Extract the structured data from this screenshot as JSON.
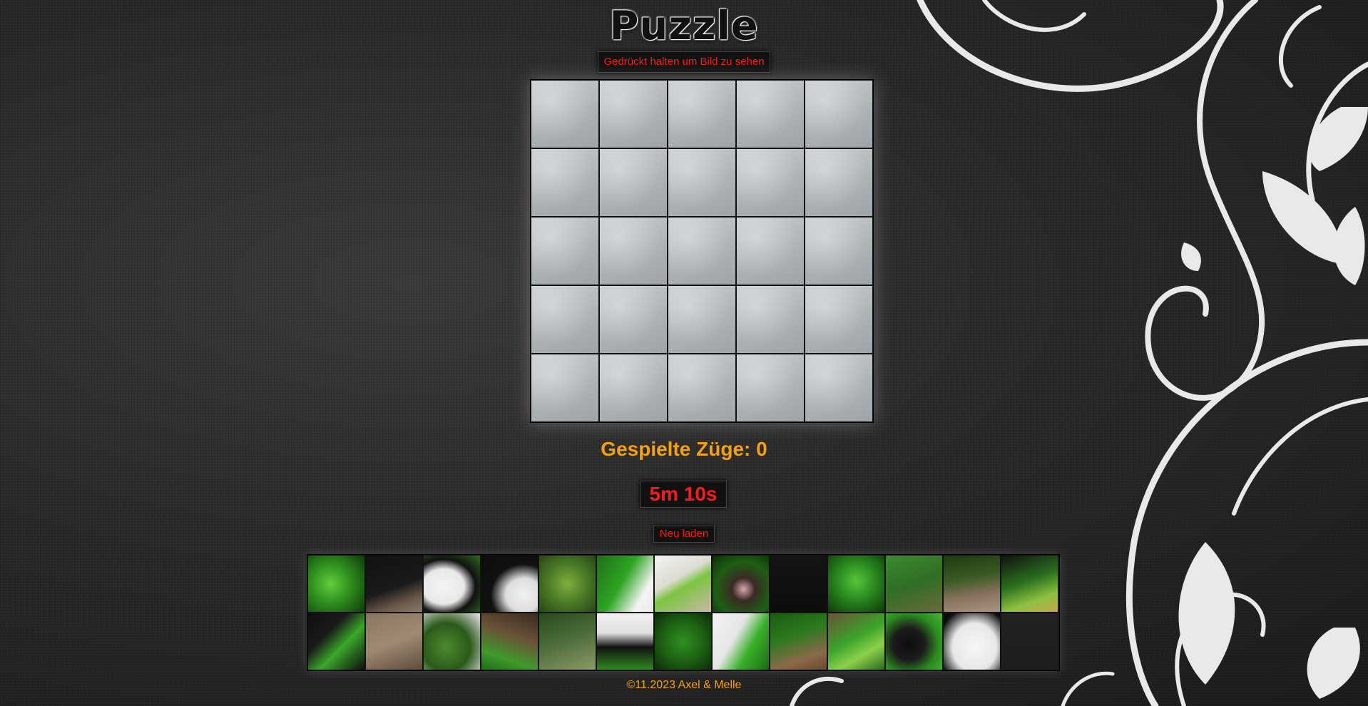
{
  "title": "Puzzle",
  "hint_button": "Gedrückt halten um Bild zu sehen",
  "board": {
    "rows": 5,
    "cols": 5,
    "cells": 25
  },
  "moves": {
    "label": "Gespielte Züge:",
    "value": "0",
    "text": "Gespielte Züge: 0"
  },
  "timer": "5m 10s",
  "reload_button": "Neu laden",
  "tray": {
    "pieces": [
      {
        "style": "radial-gradient(circle at 40% 50%, #5fcf3a 0%, #2f8f1e 45%, #0f3a0a 100%)"
      },
      {
        "style": "linear-gradient(160deg, #111 0%, #1a1a1a 55%, #6b5a4a 80%, #8a7a66 100%)"
      },
      {
        "style": "radial-gradient(ellipse at 35% 55%, #f4f4f4 0%, #e8e8e8 40%, #111 62%, #2c6e1c 100%)"
      },
      {
        "style": "radial-gradient(ellipse at 75% 70%, #f2f2f2 0%, #ddd 30%, #111 55%, #0c0c0c 100%)"
      },
      {
        "style": "radial-gradient(circle at 50% 50%, #7fae3e 0%, #4a7a26 50%, #2a4416 100%)"
      },
      {
        "style": "linear-gradient(120deg, #1f6e18 0%, #2ea522 45%, #f4f4f4 78%, #e9e9e9 100%)"
      },
      {
        "style": "linear-gradient(150deg, #f3f3f3 0%, #dcdcd2 40%, #7cc441 55%, #c9b8a6 100%)"
      },
      {
        "style": "radial-gradient(circle at 55% 60%, #d9a7b0 0%, #3a2a24 25%, #1e5f14 60%, #0c2a08 100%)"
      },
      {
        "style": "linear-gradient(180deg, #141414 0%, #0c0c0c 100%)"
      },
      {
        "style": "radial-gradient(circle at 50% 45%, #57c53a 0%, #2a8a20 45%, #0d3a08 100%)"
      },
      {
        "style": "linear-gradient(160deg, #3d8a2f 0%, #2f6e26 50%, #6b6a3a 100%)"
      },
      {
        "style": "linear-gradient(170deg, #1e3a12 0%, #3a5a22 40%, #8a7360 70%, #a89580 100%)"
      },
      {
        "style": "linear-gradient(160deg, #111 0%, #2a6e1e 45%, #8cc240 75%, #c7a24a 100%)"
      },
      {
        "style": "linear-gradient(135deg, #0f0f0f 0%, #1a1a1a 35%, #3aa82a 60%, #0d0d0d 100%)"
      },
      {
        "style": "linear-gradient(160deg, #8a7560 0%, #a08a72 50%, #5e4d3e 100%)"
      },
      {
        "style": "radial-gradient(circle at 40% 60%, #4b8a2e 0%, #2c5a1a 50%, #d9d9d9 95%)"
      },
      {
        "style": "linear-gradient(200deg, #3a2a20 0%, #6b5238 40%, #3f9a2a 75%, #1e6b14 100%)"
      },
      {
        "style": "linear-gradient(160deg, #2a4a20 0%, #4a6a38 45%, #8a9a68 100%)"
      },
      {
        "style": "linear-gradient(180deg, #f0f0f0 0%, #e0e0e0 35%, #111 60%, #2f8a22 100%)"
      },
      {
        "style": "radial-gradient(circle at 50% 50%, #2f8f22 0%, #1c5e12 55%, #0c2a08 100%)"
      },
      {
        "style": "linear-gradient(120deg, #f3f3f3 0%, #e6e6e6 40%, #3ab02a 65%, #1a6a12 100%)"
      },
      {
        "style": "linear-gradient(160deg, #1d5a14 0%, #2c7a1e 40%, #8a6a48 75%, #6a4a30 100%)"
      },
      {
        "style": "linear-gradient(150deg, #6b5038 0%, #3aa42a 45%, #8cd04a 70%, #2a6a18 100%)"
      },
      {
        "style": "radial-gradient(circle at 40% 55%, #0d0d0d 0%, #1b1b1b 35%, #2c8a20 65%, #4ab830 100%)"
      },
      {
        "style": "radial-gradient(ellipse at 55% 60%, #f6f6f6 0%, #e8e8e8 50%, #0c0c0c 85%)"
      },
      {
        "style": "linear-gradient(180deg, #222 0%, #1d1d1d 100%)"
      }
    ]
  },
  "footer": "©11.2023 Axel & Melle"
}
